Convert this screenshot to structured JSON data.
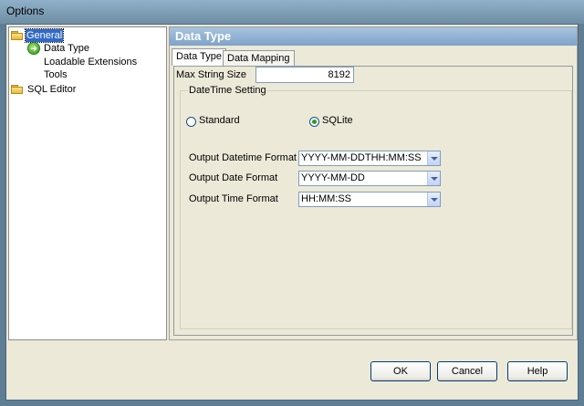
{
  "window": {
    "title": "Options"
  },
  "tree": {
    "items": [
      {
        "label": "General"
      },
      {
        "label": "Data Type"
      },
      {
        "label": "Loadable Extensions"
      },
      {
        "label": "Tools"
      },
      {
        "label": "SQL Editor"
      }
    ]
  },
  "panel": {
    "title": "Data Type",
    "tabs": [
      {
        "label": "Data Type"
      },
      {
        "label": "Data Mapping"
      }
    ],
    "max_string_size": {
      "label": "Max String Size",
      "value": "8192"
    },
    "datetime_setting": {
      "title": "DateTime Setting",
      "radios": [
        {
          "label": "Standard",
          "checked": false
        },
        {
          "label": "SQLite",
          "checked": true
        }
      ],
      "formats": [
        {
          "label": "Output Datetime Format",
          "value": "YYYY-MM-DDTHH:MM:SS"
        },
        {
          "label": "Output Date Format",
          "value": "YYYY-MM-DD"
        },
        {
          "label": "Output Time Format",
          "value": "HH:MM:SS"
        }
      ]
    }
  },
  "buttons": {
    "ok": "OK",
    "cancel": "Cancel",
    "help": "Help"
  }
}
